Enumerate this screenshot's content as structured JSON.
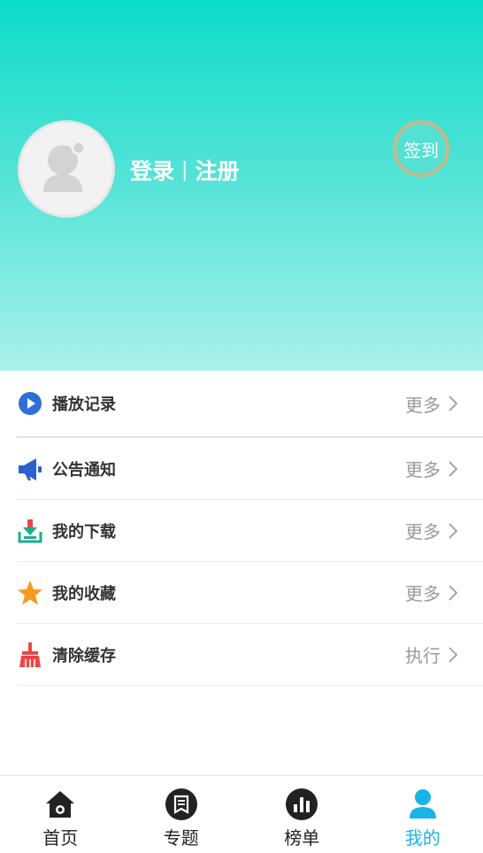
{
  "profile": {
    "login_label": "登录",
    "separator": "|",
    "register_label": "注册",
    "checkin_label": "签到"
  },
  "menu": {
    "items": [
      {
        "icon": "play-icon",
        "label": "播放记录",
        "action": "更多"
      },
      {
        "icon": "megaphone-icon",
        "label": "公告通知",
        "action": "更多"
      },
      {
        "icon": "download-icon",
        "label": "我的下载",
        "action": "更多"
      },
      {
        "icon": "star-icon",
        "label": "我的收藏",
        "action": "更多"
      },
      {
        "icon": "broom-icon",
        "label": "清除缓存",
        "action": "执行"
      }
    ]
  },
  "tabs": [
    {
      "icon": "home-icon",
      "label": "首页",
      "active": false
    },
    {
      "icon": "topic-icon",
      "label": "专题",
      "active": false
    },
    {
      "icon": "ranking-icon",
      "label": "榜单",
      "active": false
    },
    {
      "icon": "user-icon",
      "label": "我的",
      "active": true
    }
  ],
  "colors": {
    "header_top": "#0ddcca",
    "header_bottom": "#a9f1ea",
    "tab_active": "#18b4e8",
    "play": "#2c6fd6",
    "megaphone": "#2c5fcf",
    "download": "#1aaf8b",
    "star": "#f39a1e",
    "broom": "#e8484a"
  }
}
